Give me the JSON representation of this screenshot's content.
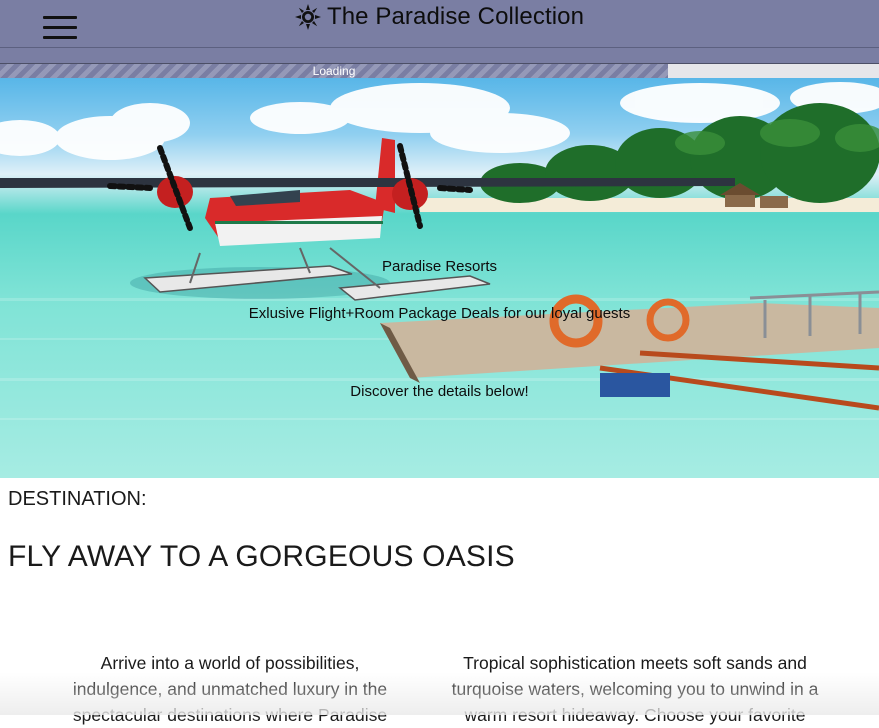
{
  "header": {
    "title": "The Paradise Collection",
    "brand_icon": "sun-icon",
    "menu_icon": "hamburger-menu-icon",
    "background_color": "#7a7ea3"
  },
  "progress": {
    "label": "Loading",
    "value_percent": 76
  },
  "hero": {
    "image": "seaplane-at-tropical-dock-photo",
    "title": "Paradise Resorts",
    "subtitle": "Exlusive Flight+Room Package Deals for our loyal guests",
    "cta": "Discover the details below!"
  },
  "content": {
    "label": "DESTINATION:",
    "heading": "FLY AWAY TO A GORGEOUS OASIS",
    "col1_lines": [
      "Arrive into a world of possibilities,",
      "indulgence, and unmatched luxury in the",
      "spectacular destinations where Paradise"
    ],
    "col2_lines": [
      "Tropical sophistication meets soft sands and",
      "turquoise waters, welcoming you to unwind in a",
      "warm resort hideaway. Choose your favorite"
    ]
  }
}
